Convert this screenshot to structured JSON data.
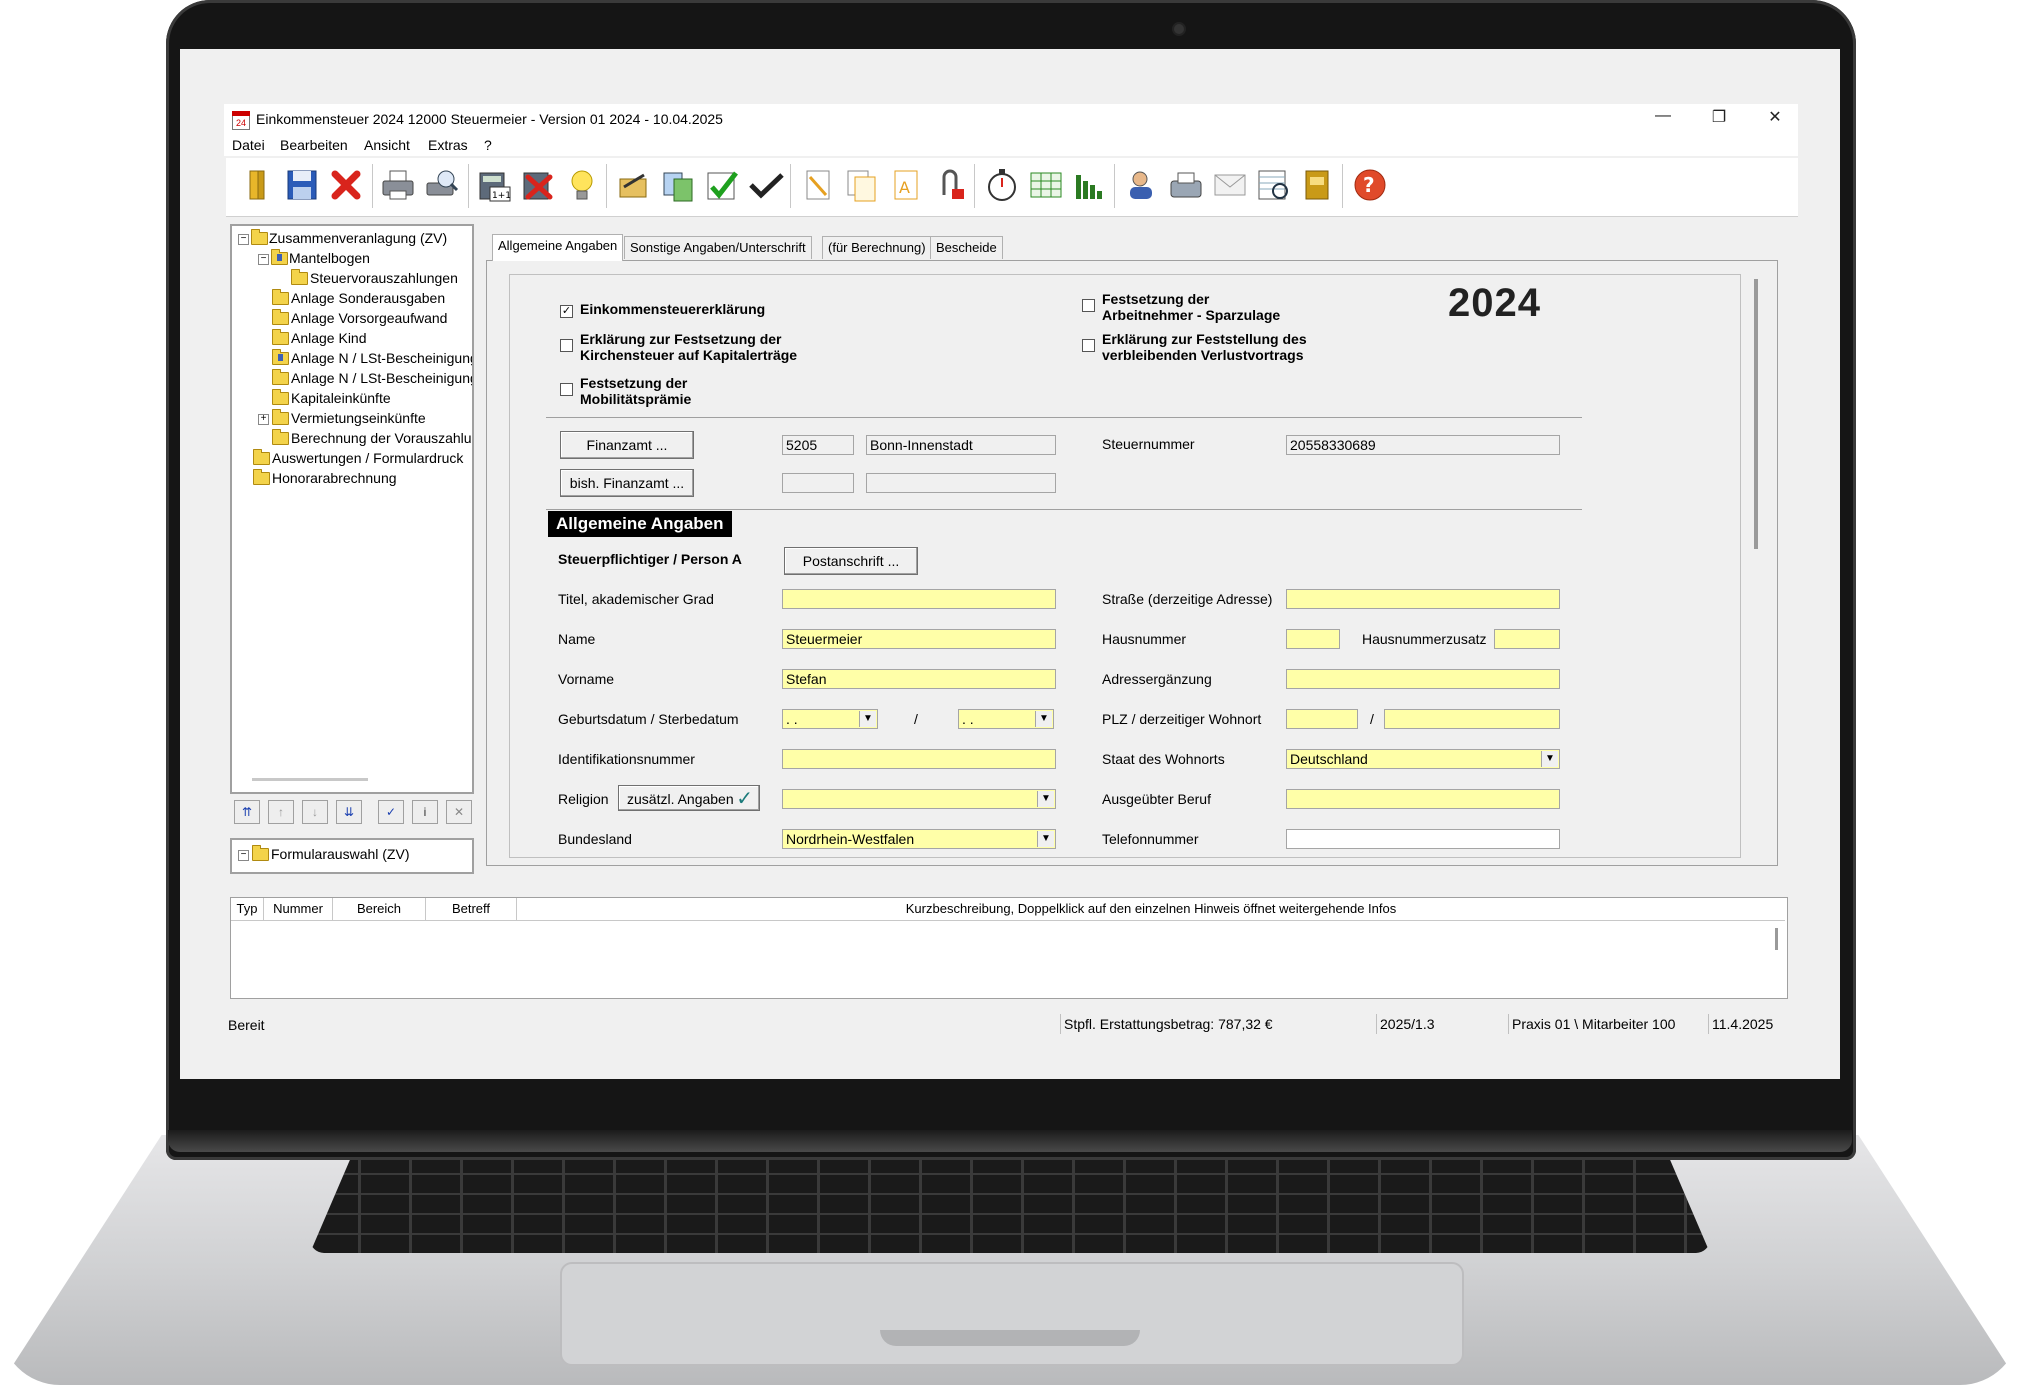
{
  "window": {
    "title": "Einkommensteuer 2024 12000 Steuermeier - Version 01 2024 - 10.04.2025",
    "icon_text": "24",
    "controls": [
      "minimize-icon",
      "restore-icon",
      "close-icon"
    ]
  },
  "menu": [
    "Datei",
    "Bearbeiten",
    "Ansicht",
    "Extras",
    "?"
  ],
  "toolbar": {
    "icons": [
      "open-book-icon",
      "save-icon",
      "delete-icon",
      "print-icon",
      "print-preview-icon",
      "calculator-icon",
      "cancel-calc-icon",
      "lightbulb-icon",
      "sign-icon",
      "transfer-icon",
      "check-icon",
      "checkmark-bird-icon",
      "document-icon",
      "document-copy-icon",
      "document-text-icon",
      "attachment-icon",
      "stopwatch-icon",
      "table-icon",
      "bar-chart-icon",
      "user-icon",
      "fax-icon",
      "mail-icon",
      "form-search-icon",
      "archive-icon",
      "help-icon"
    ]
  },
  "tree": {
    "items": [
      {
        "label": "Zusammenveranlagung (ZV)",
        "expander": "−"
      },
      {
        "label": "Mantelbogen",
        "expander": "−"
      },
      {
        "label": "Steuervorauszahlungen"
      },
      {
        "label": "Anlage Sonderausgaben"
      },
      {
        "label": "Anlage Vorsorgeaufwand"
      },
      {
        "label": "Anlage Kind"
      },
      {
        "label": "Anlage N / LSt-Bescheinigung"
      },
      {
        "label": "Anlage N / LSt-Bescheinigung"
      },
      {
        "label": "Kapitaleinkünfte"
      },
      {
        "label": "Vermietungseinkünfte",
        "expander": "+"
      },
      {
        "label": "Berechnung der Vorauszahlungen"
      },
      {
        "label": "Auswertungen / Formulardruck"
      },
      {
        "label": "Honorarabrechnung"
      }
    ],
    "buttons": [
      "move-top-icon",
      "move-up-icon",
      "move-down-icon",
      "move-bottom-icon",
      "check-icon",
      "info-icon",
      "remove-icon"
    ],
    "formselect": {
      "label": "Formularauswahl (ZV)",
      "expander": "−"
    }
  },
  "tabs": [
    "Allgemeine Angaben",
    "Sonstige Angaben/Unterschrift",
    "(für Berechnung)",
    "Bescheide"
  ],
  "form": {
    "year": "2024",
    "checkboxes": {
      "est": {
        "label": "Einkommensteuererklärung",
        "checked": true,
        "mark": "✓"
      },
      "kist_line1": "Erklärung zur Festsetzung der",
      "kist_line2": "Kirchensteuer auf Kapitalerträge",
      "mobi_line1": "Festsetzung der",
      "mobi_line2": "Mobilitätsprämie",
      "spar_line1": "Festsetzung der",
      "spar_line2": "Arbeitnehmer - Sparzulage",
      "verl_line1": "Erklärung zur Feststellung des",
      "verl_line2": "verbleibenden Verlustvortrags"
    },
    "finanzamt": {
      "button": "Finanzamt ...",
      "nr": "5205",
      "name": "Bonn-Innenstadt",
      "steuernummer_label": "Steuernummer",
      "steuernummer": "20558330689",
      "bish_button": "bish. Finanzamt ..."
    },
    "section_title": "Allgemeine Angaben",
    "person_heading": "Steuerpflichtiger / Person A",
    "postanschrift_button": "Postanschrift ...",
    "left": {
      "titel_label": "Titel, akademischer Grad",
      "titel": "",
      "name_label": "Name",
      "name": "Steuermeier",
      "vorname_label": "Vorname",
      "vorname": "Stefan",
      "geburt_label": "Geburtsdatum / Sterbedatum",
      "geburt": ". .",
      "sterbe": ". .",
      "slash": "/",
      "id_label": "Identifikationsnummer",
      "id": "",
      "religion_label": "Religion",
      "religion_button": "zusätzl. Angaben",
      "religion": "",
      "bundesland_label": "Bundesland",
      "bundesland": "Nordrhein-Westfalen"
    },
    "right": {
      "strasse_label": "Straße (derzeitige Adresse)",
      "hausnr_label": "Hausnummer",
      "hausnrzusatz_label": "Hausnummerzusatz",
      "adresserg_label": "Adressergänzung",
      "plz_label": "PLZ / derzeitiger Wohnort",
      "slash": "/",
      "staat_label": "Staat des Wohnorts",
      "staat": "Deutschland",
      "beruf_label": "Ausgeübter Beruf",
      "telefon_label": "Telefonnummer"
    }
  },
  "messages": {
    "columns": [
      "Typ",
      "Nummer",
      "Bereich",
      "Betreff",
      "Kurzbeschreibung, Doppelklick auf den einzelnen Hinweis öffnet weitergehende Infos"
    ]
  },
  "statusbar": {
    "state": "Bereit",
    "erstattung": "Stpfl. Erstattungsbetrag: 787,32 €",
    "version": "2025/1.3",
    "praxis": "Praxis 01 \\ Mitarbeiter 100",
    "date": "11.4.2025"
  }
}
